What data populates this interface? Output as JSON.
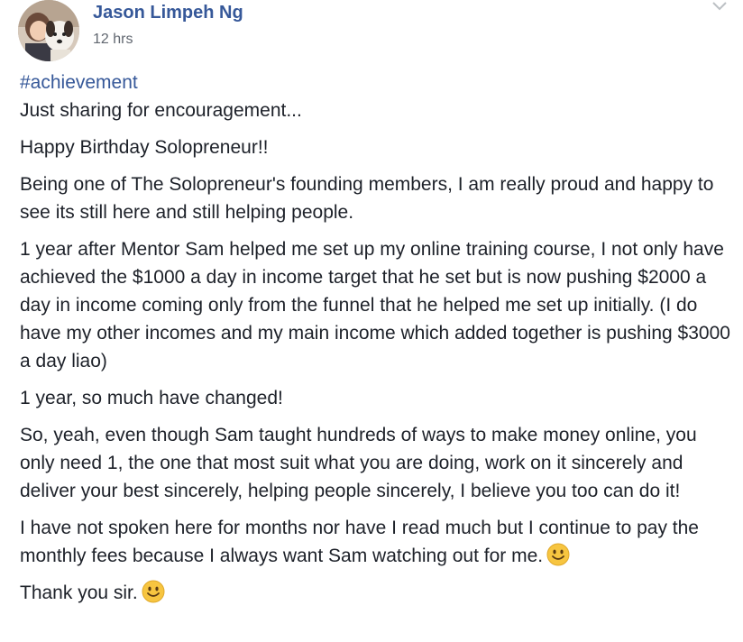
{
  "post": {
    "author": "Jason Limpeh Ng",
    "timestamp": "12 hrs",
    "hashtag": "#achievement",
    "paragraphs": {
      "p1": "Just sharing for encouragement...",
      "p2": "Happy Birthday Solopreneur!!",
      "p3": "Being one of The Solopreneur's founding members, I am really proud and happy to see its still here and still helping people.",
      "p4": "1 year after Mentor Sam helped me set up my online training course, I not only have achieved the $1000 a day in income target that he set but is now pushing $2000 a day in income coming only from the funnel that he helped me set up initially. (I do have my other incomes and my main income which added together is pushing $3000 a day liao)",
      "p5": "1 year, so much have changed!",
      "p6": "So, yeah, even though Sam taught hundreds of ways to make money online, you only need 1, the one that most suit what you are doing, work on it sincerely and deliver your best sincerely, helping people sincerely, I believe you too can do it!",
      "p7": "I have not spoken here for months nor have I read much but I continue to pay the monthly fees because I always want Sam watching out for me.",
      "p8": "Thank you sir."
    }
  },
  "icons": {
    "avatar": "avatar-photo",
    "options": "chevron-down-icon",
    "emoji": "smiley-face-icon"
  },
  "colors": {
    "link": "#365899",
    "text": "#1d2129",
    "meta": "#616770",
    "emoji": "#f7c540"
  }
}
